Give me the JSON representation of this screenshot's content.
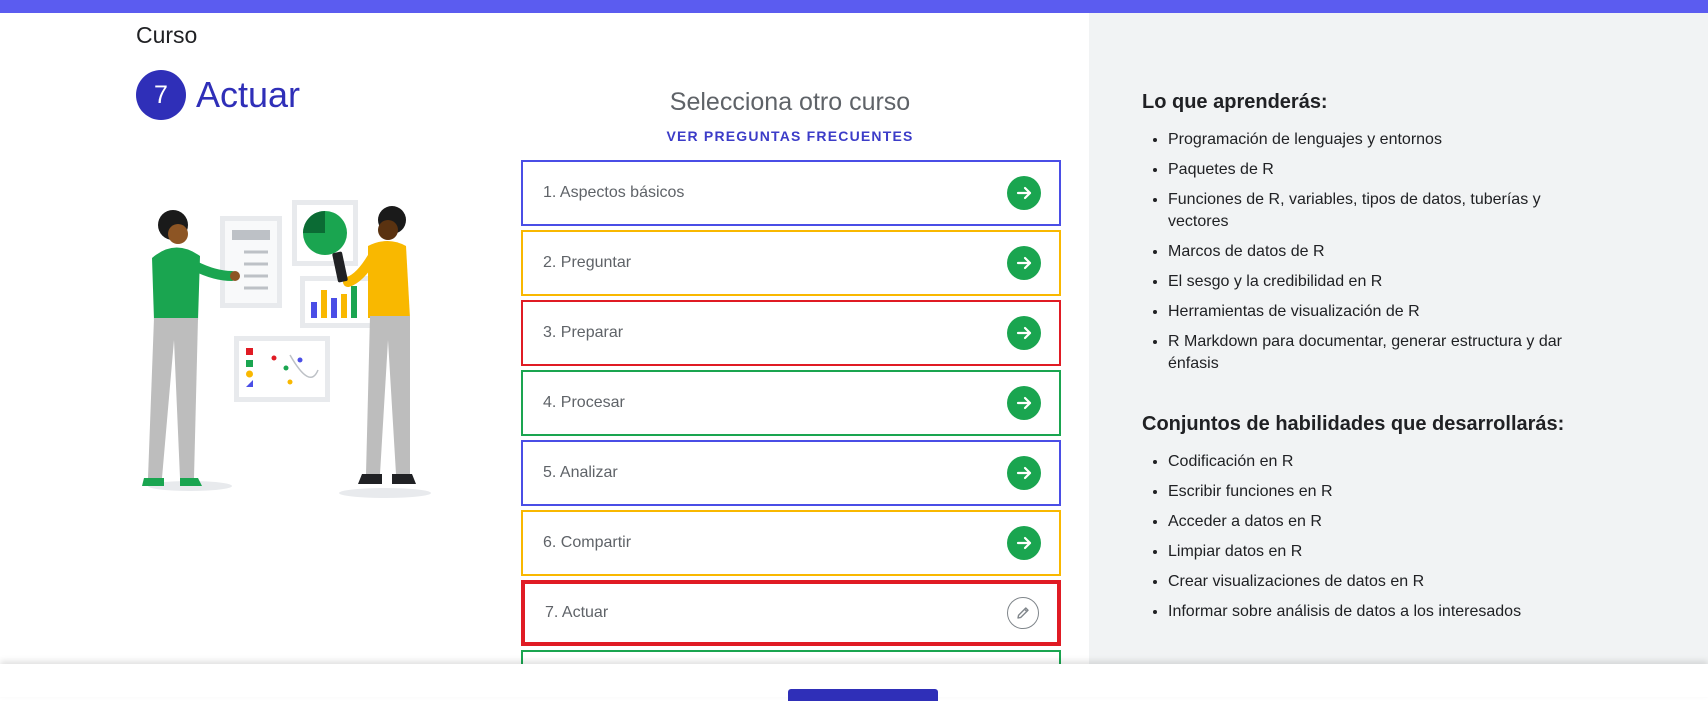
{
  "header": {
    "eyebrow": "Curso",
    "number": "7",
    "title": "Actuar",
    "accent": "#2f2fb8",
    "topbar_color": "#5b5cf0"
  },
  "selector": {
    "title": "Selecciona otro curso",
    "faq_link": "VER PREGUNTAS FRECUENTES"
  },
  "courses": [
    {
      "label": "1. Aspectos básicos",
      "border": "#4a4ee6",
      "icon": "arrow-right-icon"
    },
    {
      "label": "2. Preguntar",
      "border": "#f9b800",
      "icon": "arrow-right-icon"
    },
    {
      "label": "3. Preparar",
      "border": "#e01b24",
      "icon": "arrow-right-icon"
    },
    {
      "label": "4. Procesar",
      "border": "#1aa550",
      "icon": "arrow-right-icon"
    },
    {
      "label": "5. Analizar",
      "border": "#4a4ee6",
      "icon": "arrow-right-icon"
    },
    {
      "label": "6. Compartir",
      "border": "#f9b800",
      "icon": "arrow-right-icon"
    },
    {
      "label": "7. Actuar",
      "border": "#e01b24",
      "icon": "pencil-icon",
      "current": true
    }
  ],
  "learn": {
    "heading": "Lo que aprenderás:",
    "items": [
      "Programación de lenguajes y entornos",
      "Paquetes de R",
      "Funciones de R, variables, tipos de datos, tuberías y vectores",
      "Marcos de datos de R",
      "El sesgo y la credibilidad en R",
      "Herramientas de visualización de R",
      "R Markdown para documentar, generar estructura y dar énfasis"
    ]
  },
  "skills": {
    "heading": "Conjuntos de habilidades que desarrollarás:",
    "items": [
      "Codificación en R",
      "Escribir funciones en R",
      "Acceder a datos en R",
      "Limpiar datos en R",
      "Crear visualizaciones de datos en R",
      "Informar sobre análisis de datos a los interesados"
    ]
  }
}
